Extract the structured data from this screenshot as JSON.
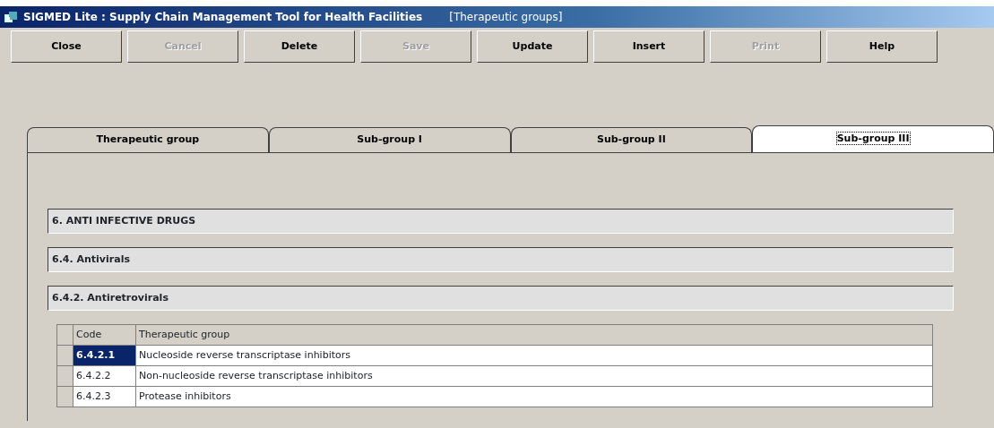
{
  "window": {
    "title": "SIGMED Lite : Supply Chain Management Tool for Health Facilities",
    "subtitle": "[Therapeutic groups]"
  },
  "toolbar": [
    {
      "label": "Close",
      "disabled": false
    },
    {
      "label": "Cancel",
      "disabled": true
    },
    {
      "label": "Delete",
      "disabled": false
    },
    {
      "label": "Save",
      "disabled": true
    },
    {
      "label": "Update",
      "disabled": false
    },
    {
      "label": "Insert",
      "disabled": false
    },
    {
      "label": "Print",
      "disabled": true
    },
    {
      "label": "Help",
      "disabled": false
    }
  ],
  "tabs": [
    {
      "label": "Therapeutic group",
      "selected": false
    },
    {
      "label": "Sub-group I",
      "selected": false
    },
    {
      "label": "Sub-group II",
      "selected": false
    },
    {
      "label": "Sub-group III",
      "selected": true
    }
  ],
  "fields": [
    {
      "value": "6. ANTI INFECTIVE DRUGS"
    },
    {
      "value": "6.4. Antivirals"
    },
    {
      "value": "6.4.2. Antiretrovirals"
    }
  ],
  "table": {
    "columns": [
      "Code",
      "Therapeutic group"
    ],
    "rows": [
      {
        "code": "6.4.2.1",
        "group": "Nucleoside reverse transcriptase inhibitors",
        "selected": true
      },
      {
        "code": "6.4.2.2",
        "group": "Non-nucleoside reverse transcriptase inhibitors",
        "selected": false
      },
      {
        "code": "6.4.2.3",
        "group": "Protease inhibitors",
        "selected": false
      }
    ]
  }
}
